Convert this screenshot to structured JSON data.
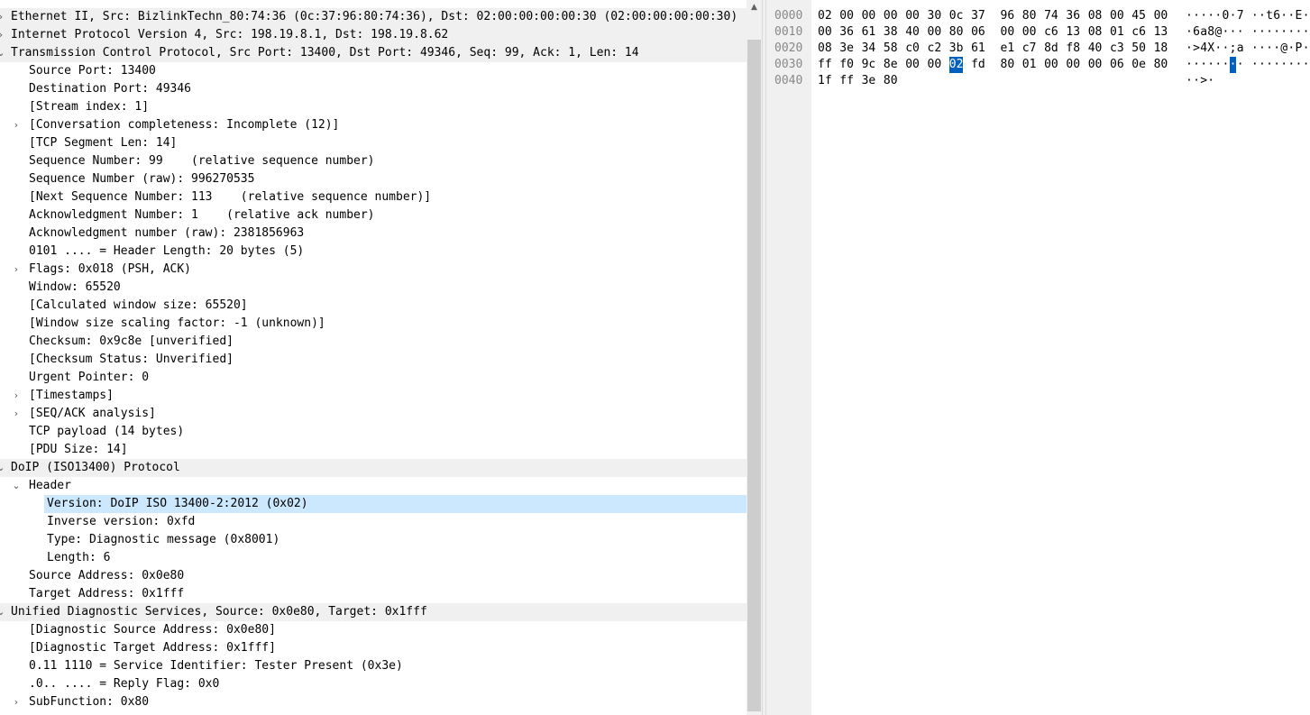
{
  "tree": [
    {
      "indent": 0,
      "arrow": "›",
      "text": "Ethernet II, Src: BizlinkTechn_80:74:36 (0c:37:96:80:74:36), Dst: 02:00:00:00:00:30 (02:00:00:00:00:30)",
      "type": "section"
    },
    {
      "indent": 0,
      "arrow": "›",
      "text": "Internet Protocol Version 4, Src: 198.19.8.1, Dst: 198.19.8.62",
      "type": "section"
    },
    {
      "indent": 0,
      "arrow": "⌄",
      "text": "Transmission Control Protocol, Src Port: 13400, Dst Port: 49346, Seq: 99, Ack: 1, Len: 14",
      "type": "section"
    },
    {
      "indent": 1,
      "arrow": "",
      "text": "Source Port: 13400"
    },
    {
      "indent": 1,
      "arrow": "",
      "text": "Destination Port: 49346"
    },
    {
      "indent": 1,
      "arrow": "",
      "text": "[Stream index: 1]"
    },
    {
      "indent": 1,
      "arrow": "›",
      "text": "[Conversation completeness: Incomplete (12)]"
    },
    {
      "indent": 1,
      "arrow": "",
      "text": "[TCP Segment Len: 14]"
    },
    {
      "indent": 1,
      "arrow": "",
      "text": "Sequence Number: 99    (relative sequence number)"
    },
    {
      "indent": 1,
      "arrow": "",
      "text": "Sequence Number (raw): 996270535"
    },
    {
      "indent": 1,
      "arrow": "",
      "text": "[Next Sequence Number: 113    (relative sequence number)]"
    },
    {
      "indent": 1,
      "arrow": "",
      "text": "Acknowledgment Number: 1    (relative ack number)"
    },
    {
      "indent": 1,
      "arrow": "",
      "text": "Acknowledgment number (raw): 2381856963"
    },
    {
      "indent": 1,
      "arrow": "",
      "text": "0101 .... = Header Length: 20 bytes (5)"
    },
    {
      "indent": 1,
      "arrow": "›",
      "text": "Flags: 0x018 (PSH, ACK)"
    },
    {
      "indent": 1,
      "arrow": "",
      "text": "Window: 65520"
    },
    {
      "indent": 1,
      "arrow": "",
      "text": "[Calculated window size: 65520]"
    },
    {
      "indent": 1,
      "arrow": "",
      "text": "[Window size scaling factor: -1 (unknown)]"
    },
    {
      "indent": 1,
      "arrow": "",
      "text": "Checksum: 0x9c8e [unverified]"
    },
    {
      "indent": 1,
      "arrow": "",
      "text": "[Checksum Status: Unverified]"
    },
    {
      "indent": 1,
      "arrow": "",
      "text": "Urgent Pointer: 0"
    },
    {
      "indent": 1,
      "arrow": "›",
      "text": "[Timestamps]"
    },
    {
      "indent": 1,
      "arrow": "›",
      "text": "[SEQ/ACK analysis]"
    },
    {
      "indent": 1,
      "arrow": "",
      "text": "TCP payload (14 bytes)"
    },
    {
      "indent": 1,
      "arrow": "",
      "text": "[PDU Size: 14]"
    },
    {
      "indent": 0,
      "arrow": "⌄",
      "text": "DoIP (ISO13400) Protocol",
      "type": "section"
    },
    {
      "indent": 1,
      "arrow": "⌄",
      "text": "Header"
    },
    {
      "indent": 2,
      "arrow": "",
      "text": "Version: DoIP ISO 13400-2:2012 (0x02)",
      "type": "selected"
    },
    {
      "indent": 2,
      "arrow": "",
      "text": "Inverse version: 0xfd"
    },
    {
      "indent": 2,
      "arrow": "",
      "text": "Type: Diagnostic message (0x8001)"
    },
    {
      "indent": 2,
      "arrow": "",
      "text": "Length: 6"
    },
    {
      "indent": 1,
      "arrow": "",
      "text": "Source Address: 0x0e80"
    },
    {
      "indent": 1,
      "arrow": "",
      "text": "Target Address: 0x1fff"
    },
    {
      "indent": 0,
      "arrow": "⌄",
      "text": "Unified Diagnostic Services, Source: 0x0e80, Target: 0x1fff",
      "type": "section"
    },
    {
      "indent": 1,
      "arrow": "",
      "text": "[Diagnostic Source Address: 0x0e80]"
    },
    {
      "indent": 1,
      "arrow": "",
      "text": "[Diagnostic Target Address: 0x1fff]"
    },
    {
      "indent": 1,
      "arrow": "",
      "text": "0.11 1110 = Service Identifier: Tester Present (0x3e)"
    },
    {
      "indent": 1,
      "arrow": "",
      "text": ".0.. .... = Reply Flag: 0x0"
    },
    {
      "indent": 1,
      "arrow": "›",
      "text": "SubFunction: 0x80"
    }
  ],
  "hex": [
    {
      "offset": "0000",
      "bytes": [
        "02",
        "00",
        "00",
        "00",
        "00",
        "30",
        "0c",
        "37",
        "96",
        "80",
        "74",
        "36",
        "08",
        "00",
        "45",
        "00"
      ],
      "ascii": [
        "·",
        "·",
        "·",
        "·",
        "·",
        "0",
        "·",
        "7",
        "·",
        "·",
        "t",
        "6",
        "·",
        "·",
        "E",
        "·"
      ]
    },
    {
      "offset": "0010",
      "bytes": [
        "00",
        "36",
        "61",
        "38",
        "40",
        "00",
        "80",
        "06",
        "00",
        "00",
        "c6",
        "13",
        "08",
        "01",
        "c6",
        "13"
      ],
      "ascii": [
        "·",
        "6",
        "a",
        "8",
        "@",
        "·",
        "·",
        "·",
        "·",
        "·",
        "·",
        "·",
        "·",
        "·",
        "·",
        "·"
      ]
    },
    {
      "offset": "0020",
      "bytes": [
        "08",
        "3e",
        "34",
        "58",
        "c0",
        "c2",
        "3b",
        "61",
        "e1",
        "c7",
        "8d",
        "f8",
        "40",
        "c3",
        "50",
        "18"
      ],
      "ascii": [
        "·",
        ">",
        "4",
        "X",
        "·",
        "·",
        ";",
        "a",
        "·",
        "·",
        "·",
        "·",
        "@",
        "·",
        "P",
        "·"
      ]
    },
    {
      "offset": "0030",
      "bytes": [
        "ff",
        "f0",
        "9c",
        "8e",
        "00",
        "00",
        "02",
        "fd",
        "80",
        "01",
        "00",
        "00",
        "00",
        "06",
        "0e",
        "80"
      ],
      "ascii": [
        "·",
        "·",
        "·",
        "·",
        "·",
        "·",
        "·",
        "·",
        "·",
        "·",
        "·",
        "·",
        "·",
        "·",
        "·",
        "·"
      ]
    },
    {
      "offset": "0040",
      "bytes": [
        "1f",
        "ff",
        "3e",
        "80"
      ],
      "ascii": [
        "·",
        "·",
        ">",
        "·"
      ]
    }
  ],
  "hex_selection": {
    "row": 3,
    "col": 6
  }
}
